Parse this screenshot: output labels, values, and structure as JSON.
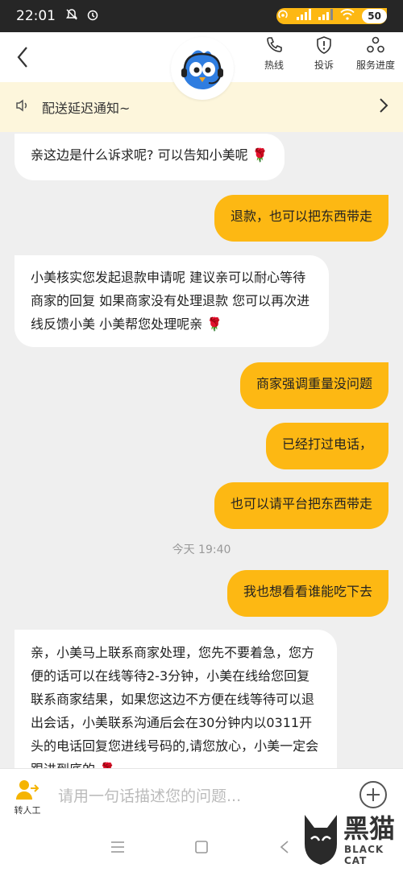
{
  "statusbar": {
    "time": "22:01",
    "battery": "50"
  },
  "header": {
    "actions": [
      {
        "label": "热线"
      },
      {
        "label": "投诉"
      },
      {
        "label": "服务进度"
      }
    ]
  },
  "notice": {
    "text": "配送延迟通知~"
  },
  "messages": [
    {
      "side": "left",
      "text": "亲这边是什么诉求呢? 可以告知小美呢"
    },
    {
      "side": "right",
      "text": "退款，也可以把东西带走"
    },
    {
      "side": "left",
      "text": "小美核实您发起退款申请呢 建议亲可以耐心等待商家的回复 如果商家没有处理退款 您可以再次进线反馈小美 小美帮您处理呢亲"
    },
    {
      "side": "right",
      "text": "商家强调重量没问题"
    },
    {
      "side": "right",
      "text": "已经打过电话，"
    },
    {
      "side": "right",
      "text": "也可以请平台把东西带走"
    },
    {
      "side": "right",
      "text": "我也想看看谁能吃下去"
    },
    {
      "side": "left",
      "text": "亲，小美马上联系商家处理，您先不要着急，您方便的话可以在线等待2-3分钟，小美在线给您回复联系商家结果，如果您这边不方便在线等待可以退出会话，小美联系沟通后会在30分钟内以0311开头的电话回复您进线号码的,请您放心，小美一定会跟进到底的"
    }
  ],
  "timestamp": "今天 19:40",
  "inputbar": {
    "to_human_label": "转人工",
    "placeholder": "请用一句话描述您的问题..."
  },
  "watermark": {
    "text": "黑猫",
    "sub": "BLACK CAT"
  }
}
